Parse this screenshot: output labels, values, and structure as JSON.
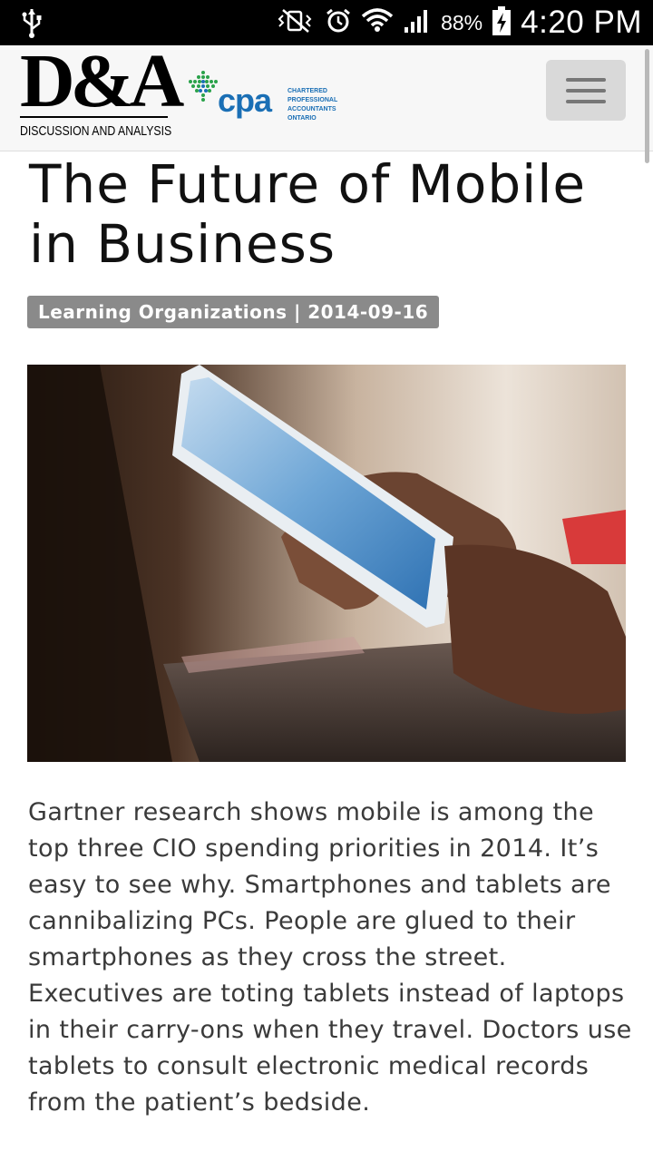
{
  "status_bar": {
    "battery_percent": "88%",
    "time": "4:20 PM"
  },
  "header": {
    "logo_mark": "D&A",
    "logo_subtitle": "DISCUSSION AND ANALYSIS",
    "partner_logo_text": "cpa",
    "partner_logo_lines": [
      "CHARTERED",
      "PROFESSIONAL",
      "ACCOUNTANTS",
      "ONTARIO"
    ]
  },
  "article": {
    "title": "The Future of Mobile in Business",
    "meta": "Learning Organizations | 2014-09-16",
    "body": "Gartner research shows mobile is among the top three CIO spending priorities in 2014. It’s easy to see why. Smartphones and tablets are cannibalizing PCs. People are glued to their smartphones as they cross the street. Executives are toting tablets instead of laptops in their carry-ons when they travel. Doctors use tablets to consult electronic medical records from the patient’s bedside."
  },
  "colors": {
    "cpa_blue": "#1a6fb5",
    "badge_gray": "#8a8a8a"
  }
}
